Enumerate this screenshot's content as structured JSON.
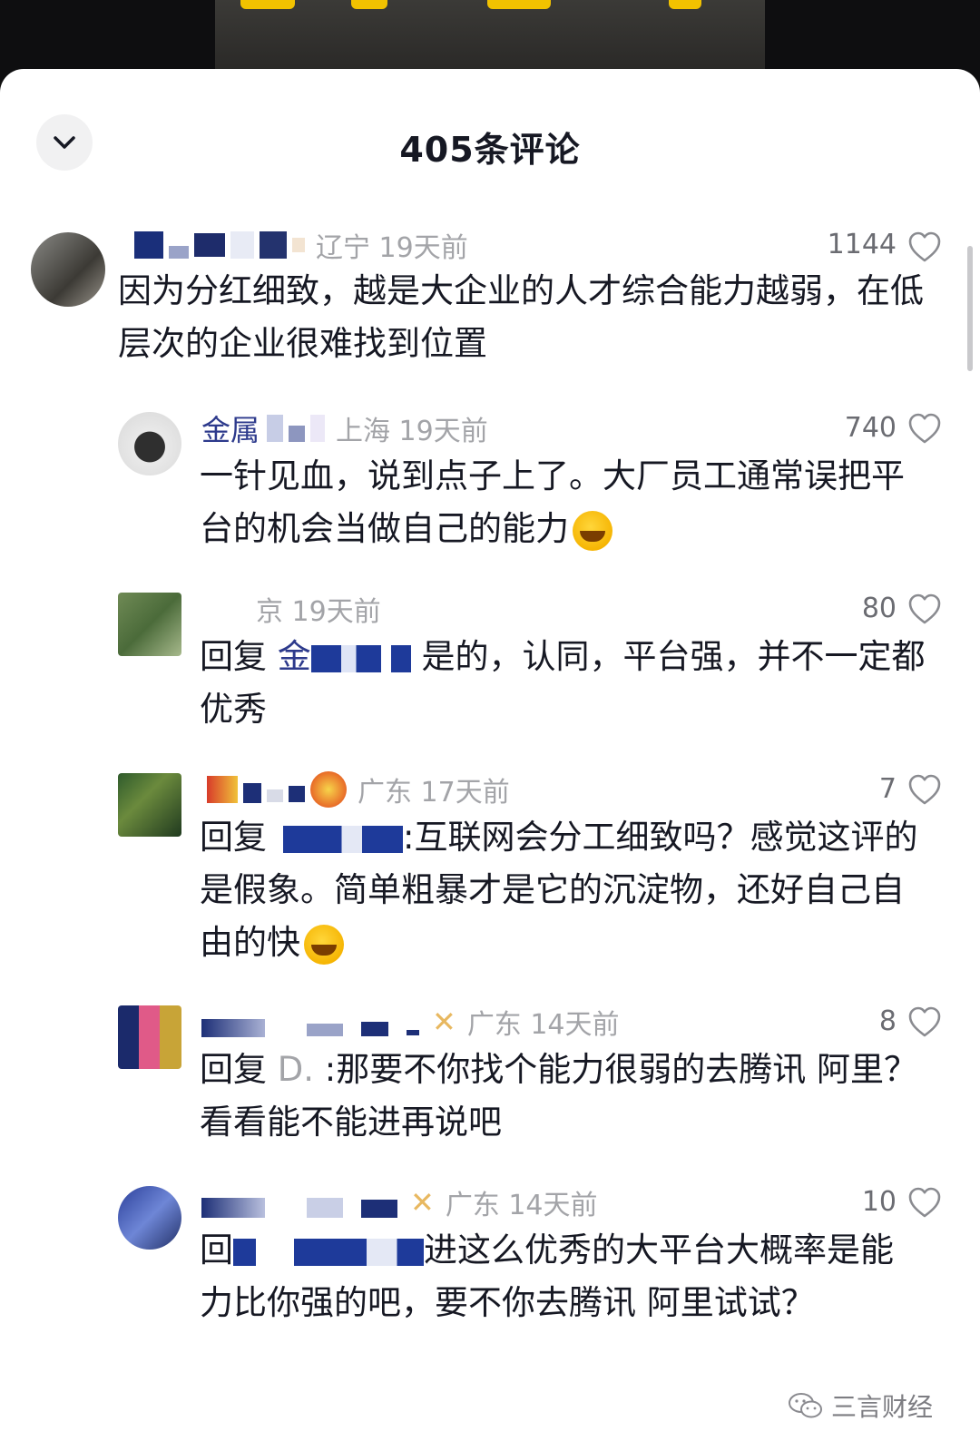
{
  "header": {
    "title": "405条评论"
  },
  "comments": [
    {
      "location_time": "辽宁 19天前",
      "likes": "1144",
      "text": "因为分红细致，越是大企业的人才综合能力越弱，在低层次的企业很难找到位置",
      "reply_prefix": "",
      "emoji": false
    },
    {
      "name_visible": "金属",
      "location_time": "上海 19天前",
      "likes": "740",
      "text": "一针见血，说到点子上了。大厂员工通常误把平台的机会当做自己的能力",
      "reply_prefix": "",
      "emoji": true
    },
    {
      "location_time": "京 19天前",
      "likes": "80",
      "reply_prefix": "回复",
      "mention_visible": "金",
      "text": "是的，认同，平台强，并不一定都优秀",
      "emoji": false
    },
    {
      "location_time": "广东 17天前",
      "likes": "7",
      "reply_prefix": "回复",
      "text": ":互联网会分工细致吗？感觉这评的是假象。简单粗暴才是它的沉淀物，还好自己自由的快",
      "emoji": true
    },
    {
      "location_time": "广东 14天前",
      "likes": "8",
      "reply_prefix": "回复",
      "mention_visible": "D.",
      "text": ":那要不你找个能力很弱的去腾讯 阿里？看看能不能进再说吧",
      "emoji": false
    },
    {
      "location_time": "广东 14天前",
      "likes": "10",
      "reply_prefix": "回",
      "text": "进这么优秀的大平台大概率是能力比你强的吧，要不你去腾讯 阿里试试？",
      "emoji": false
    }
  ],
  "watermark": {
    "text": "三言财经"
  },
  "colors": {
    "sheet": "#ffffff",
    "text": "#161823",
    "meta": "#a3a4a8",
    "like": "#6b6c72"
  },
  "icons": {
    "collapse": "chevron-down-icon",
    "like": "heart-outline-icon",
    "watermark": "wechat-icon"
  }
}
